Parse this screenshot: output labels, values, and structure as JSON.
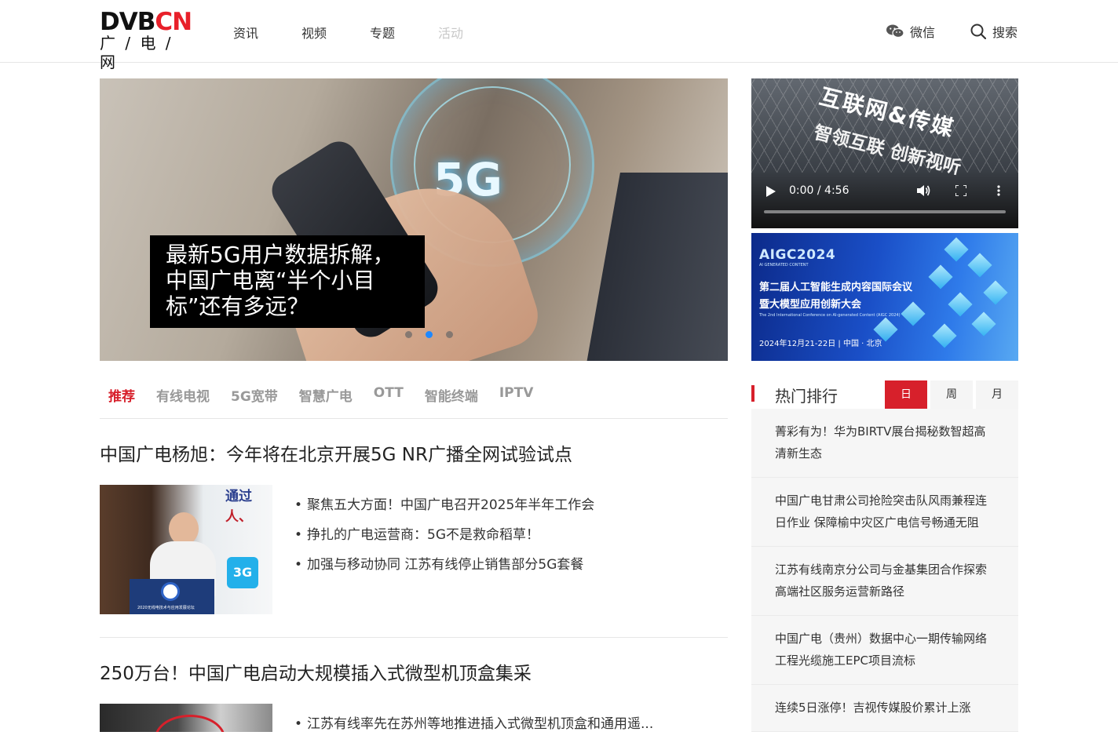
{
  "logo": {
    "brand_main": "DVB",
    "brand_accent": "CN",
    "tagline": "广 / 电 / 网"
  },
  "nav": {
    "items": [
      "资讯",
      "视频",
      "专题",
      "活动"
    ]
  },
  "header_right": {
    "wechat_label": "微信",
    "search_label": "搜索"
  },
  "hero": {
    "caption": "最新5G用户数据拆解，中国广电离“半个小目标”还有多远？",
    "image_text": "5G",
    "slides": 3,
    "active_slide": 2
  },
  "video": {
    "sign_line1": "互联网&传媒",
    "sign_line2": "智领互联 创新视听",
    "time": "0:00 / 4:56",
    "progress": 0
  },
  "banner": {
    "logo": "AIGC2024",
    "logo_sub": "AI GENERATED CONTENT",
    "title_line1": "第二届人工智能生成内容国际会议",
    "title_line2": "暨大模型应用创新大会",
    "en_title": "The 2nd International Conference on AI-generated Content (AIGC 2024)",
    "date_place": "2024年12月21-22日 | 中国 · 北京"
  },
  "categories": [
    "推荐",
    "有线电视",
    "5G宽带",
    "智慧广电",
    "OTT",
    "智能终端",
    "IPTV"
  ],
  "articles": [
    {
      "title": "中国广电杨旭：今年将在北京开展5G NR广播全网试验试点",
      "thumb_text": [
        "通过",
        "人、",
        "3G",
        "2020无线电技术与应用发展论坛"
      ],
      "bullets": [
        "聚焦五大方面！中国广电召开2025年半年工作会",
        "挣扎的广电运营商：5G不是救命稻草！",
        "加强与移动协同 江苏有线停止销售部分5G套餐"
      ]
    },
    {
      "title": "250万台！中国广电启动大规模插入式微型机顶盒集采",
      "bullets": [
        "江苏有线率先在苏州等地推进插入式微型机顶盒和通用遥..."
      ]
    }
  ],
  "ranking": {
    "title": "热门排行",
    "tabs": [
      "日",
      "周",
      "月"
    ],
    "active_tab": 0,
    "items": [
      "菁彩有为！华为BIRTV展台揭秘数智超高清新生态",
      "中国广电甘肃公司抢险突击队风雨兼程连日作业 保障榆中灾区广电信号畅通无阻",
      "江苏有线南京分公司与金基集团合作探索高端社区服务运营新路径",
      "中国广电（贵州）数据中心一期传输网络工程光缆施工EPC项目流标",
      "连续5日涨停！吉视传媒股价累计上涨"
    ]
  },
  "colors": {
    "accent": "#d7202b",
    "logo_red": "#e8202a",
    "slider_active": "#1e88ff"
  }
}
